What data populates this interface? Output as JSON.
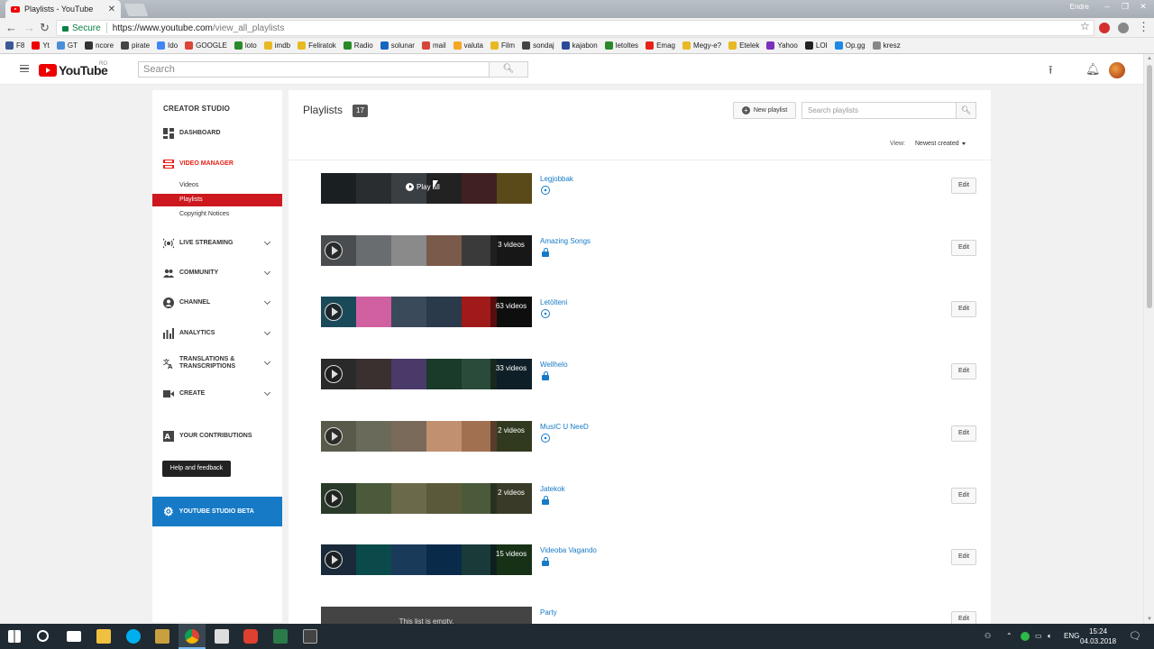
{
  "browser": {
    "tab_title": "Playlists - YouTube",
    "tab_close": "✕",
    "window_user": "Endre",
    "secure_label": "Secure",
    "url_host": "https://www.youtube.com",
    "url_path": "/view_all_playlists",
    "bookmarks": [
      "F8",
      "Yt",
      "GT",
      "ncore",
      "pirate",
      "Ido",
      "GOOGLE",
      "loto",
      "imdb",
      "Feliratok",
      "Radio",
      "solunar",
      "mail",
      "valuta",
      "Film",
      "sondaj",
      "kajabon",
      "letoltes",
      "Emag",
      "Megy-e?",
      "Etelek",
      "Yahoo",
      "LOI",
      "Op.gg",
      "kresz"
    ],
    "bookmark_colors": [
      "#3b5998",
      "#e00",
      "#4a90d9",
      "#333",
      "#444",
      "#4285f4",
      "#db4437",
      "#2a8a2a",
      "#e8b923",
      "#e8b923",
      "#2a8a2a",
      "#1565c0",
      "#d44638",
      "#f5a623",
      "#e8b923",
      "#444",
      "#2c4a9a",
      "#2a8a2a",
      "#e62117",
      "#e8b923",
      "#e8b923",
      "#7b2fbe",
      "#222",
      "#1e88e5",
      "#888"
    ]
  },
  "header": {
    "logo_text": "YouTube",
    "logo_region": "RO",
    "search_placeholder": "Search"
  },
  "sidebar": {
    "title": "CREATOR STUDIO",
    "items": [
      {
        "label": "DASHBOARD"
      },
      {
        "label": "VIDEO MANAGER"
      },
      {
        "label": "LIVE STREAMING"
      },
      {
        "label": "COMMUNITY"
      },
      {
        "label": "CHANNEL"
      },
      {
        "label": "ANALYTICS"
      },
      {
        "label": "TRANSLATIONS & TRANSCRIPTIONS"
      },
      {
        "label": "CREATE"
      },
      {
        "label": "YOUR CONTRIBUTIONS"
      }
    ],
    "sub_items": [
      "Videos",
      "Playlists",
      "Copyright Notices"
    ],
    "help_label": "Help and feedback",
    "beta_label": "YOUTUBE STUDIO BETA"
  },
  "main": {
    "title": "Playlists",
    "count": "17",
    "new_playlist": "New playlist",
    "search_placeholder": "Search playlists",
    "view_label": "View:",
    "sort_label": "Newest created",
    "edit_label": "Edit",
    "play_all_label": "Play all",
    "empty_label": "This list is empty.",
    "playlists": [
      {
        "name": "Legjobbak",
        "videos": "",
        "privacy": "public",
        "colors": [
          "#1a1f22",
          "#2a2d30",
          "#3a3f44",
          "#222",
          "#402020",
          "#5a4a1a"
        ]
      },
      {
        "name": "Amazing Songs",
        "videos": "3 videos",
        "privacy": "private",
        "colors": [
          "#4a4d50",
          "#6a6d70",
          "#8a8a8a",
          "#7a5a4a",
          "#3a3a3a",
          "#2a2a2a"
        ]
      },
      {
        "name": "Letölteni",
        "videos": "63 videos",
        "privacy": "public",
        "colors": [
          "#1a4a5a",
          "#d060a0",
          "#3a4a5a",
          "#2a3a4a",
          "#a01a1a",
          "#1a1a1a"
        ]
      },
      {
        "name": "Wellhelo",
        "videos": "33 videos",
        "privacy": "private",
        "colors": [
          "#2a2a2a",
          "#3a3030",
          "#4a3a6a",
          "#1a3a2a",
          "#2a4a3a",
          "#1a3a4a"
        ]
      },
      {
        "name": "MusIC U NeeD",
        "videos": "2 videos",
        "privacy": "public",
        "colors": [
          "#5a5a4a",
          "#6a6a5a",
          "#7a6a5a",
          "#c09070",
          "#a07050",
          "#5a6a3a"
        ]
      },
      {
        "name": "Jatekok",
        "videos": "2 videos",
        "privacy": "private",
        "colors": [
          "#2a3a2a",
          "#4a5a3a",
          "#6a6a4a",
          "#5a5a3a",
          "#4a5a3a",
          "#6a6a4a"
        ]
      },
      {
        "name": "Videoba Vagando",
        "videos": "15 videos",
        "privacy": "private",
        "colors": [
          "#1a2a3a",
          "#0a4a4a",
          "#1a3a5a",
          "#0a2a4a",
          "#1a3a3a",
          "#2a5a2a"
        ]
      },
      {
        "name": "Party",
        "videos": "",
        "privacy": "empty",
        "colors": []
      }
    ]
  },
  "taskbar": {
    "lang": "ENG",
    "time": "15:24",
    "date": "04.03.2018"
  }
}
